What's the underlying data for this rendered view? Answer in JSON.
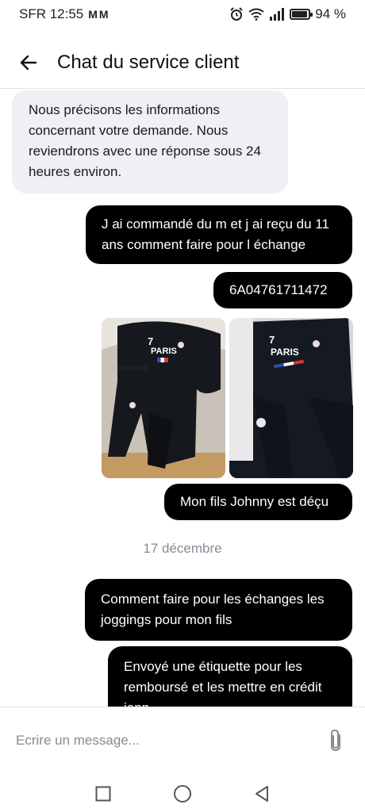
{
  "status_bar": {
    "carrier_time": "SFR 12:55",
    "mail_icons": "M M",
    "battery_percent_text": "94 %",
    "battery_level": 0.94
  },
  "header": {
    "title": "Chat du service client",
    "back_icon": "arrow-left-icon"
  },
  "messages": [
    {
      "from": "agent",
      "text": "Nous précisons les informations concernant votre demande. Nous reviendrons avec une réponse sous 24 heures environ."
    },
    {
      "from": "user",
      "text": "J ai commandé du m et j ai reçu du 11 ans comment faire pour l échange"
    },
    {
      "from": "user",
      "text": "6A04761711472"
    },
    {
      "from": "user",
      "type": "images",
      "labels": [
        "7",
        "PARIS",
        "7",
        "PARIS"
      ]
    },
    {
      "from": "user",
      "text": "Mon fils Johnny est déçu"
    },
    {
      "from": "user",
      "text": "Comment faire pour les échanges les joggings pour mon fils"
    },
    {
      "from": "user",
      "text": "Envoyé une étiquette pour les remboursé et les mettre en crédit jenn"
    }
  ],
  "date_separator": "17 décembre",
  "composer": {
    "placeholder": "Ecrire un message...",
    "attach_icon": "paperclip-icon"
  },
  "nav": {
    "recents_icon": "square-icon",
    "home_icon": "circle-icon",
    "back_icon": "triangle-back-icon"
  },
  "colors": {
    "user_bubble": "#000000",
    "agent_bubble": "#eef0f3",
    "date_text": "#8a8a99"
  }
}
